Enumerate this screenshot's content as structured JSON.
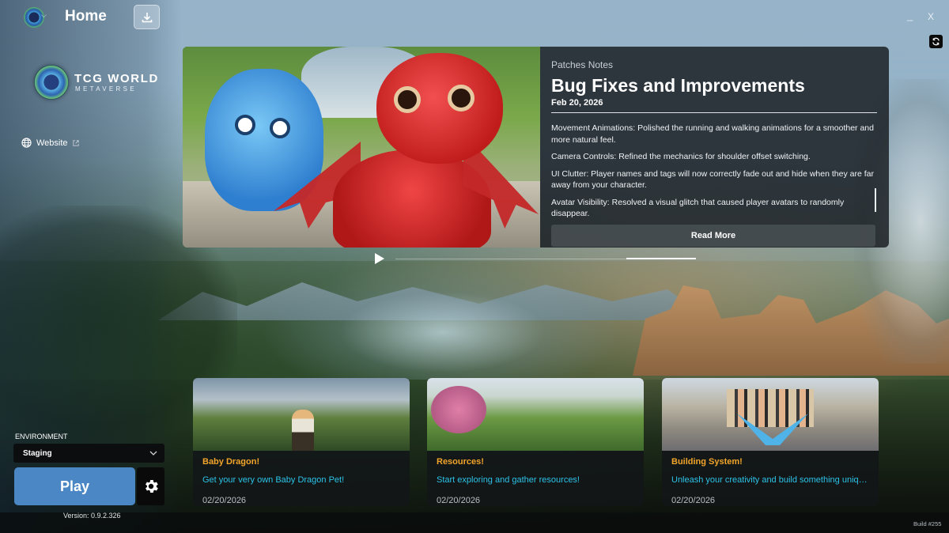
{
  "header": {
    "title": "Home",
    "icons": {
      "logo": "tcg-logo-icon",
      "download": "download-icon",
      "refresh": "refresh-icon"
    }
  },
  "window": {
    "minimize_label": "_",
    "close_label": "X"
  },
  "brand": {
    "name": "TCG WORLD",
    "subtitle": "METAVERSE"
  },
  "sidebar": {
    "website_label": "Website"
  },
  "hero": {
    "eyebrow": "Patches Notes",
    "title": "Bug Fixes and Improvements",
    "date": "Feb 20, 2026",
    "notes": [
      "Movement Animations: Polished the running and walking animations for a smoother and more natural feel.",
      "Camera Controls: Refined the mechanics for shoulder offset switching.",
      "UI Clutter: Player names and tags will now correctly fade out and hide when they are far away from your character.",
      "Avatar Visibility: Resolved a visual glitch that caused player avatars to randomly disappear."
    ],
    "read_more_label": "Read More"
  },
  "cards": [
    {
      "title": "Baby Dragon!",
      "description": "Get your very own Baby Dragon Pet!",
      "date": "02/20/2026"
    },
    {
      "title": "Resources!",
      "description": "Start exploring and gather resources!",
      "date": "02/20/2026"
    },
    {
      "title": "Building System!",
      "description": "Unleash your creativity and build something unique and amazing!",
      "date": "02/20/2026"
    }
  ],
  "environment": {
    "label": "ENVIRONMENT",
    "selected": "Staging"
  },
  "play": {
    "label": "Play"
  },
  "footer": {
    "version": "Version: 0.9.2.326",
    "build": "Build #255"
  },
  "colors": {
    "accent": "#4a87c4",
    "card_title": "#f2a52a",
    "card_desc": "#2cc3e8"
  }
}
